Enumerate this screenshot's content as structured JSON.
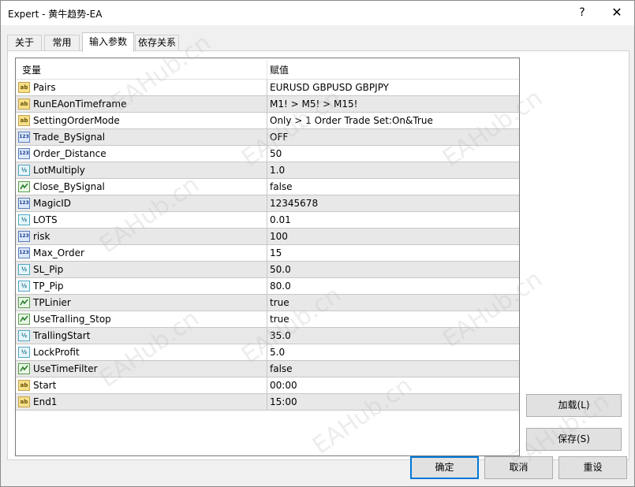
{
  "window": {
    "title": "Expert - 黄牛趋势-EA",
    "help_label": "?",
    "close_label": "✕"
  },
  "tabs": [
    {
      "label": "关于"
    },
    {
      "label": "常用"
    },
    {
      "label": "输入参数"
    },
    {
      "label": "依存关系"
    }
  ],
  "grid": {
    "header": {
      "variable": "变量",
      "value": "赋值"
    },
    "rows": [
      {
        "type": "ab",
        "name": "Pairs",
        "value": "EURUSD GBPUSD GBPJPY"
      },
      {
        "type": "ab",
        "name": "RunEAonTimeframe",
        "value": "M1! > M5! > M15!"
      },
      {
        "type": "ab",
        "name": "SettingOrderMode",
        "value": "Only > 1 Order Trade Set:On&True"
      },
      {
        "type": "123",
        "name": "Trade_BySignal",
        "value": "OFF"
      },
      {
        "type": "123",
        "name": "Order_Distance",
        "value": "50"
      },
      {
        "type": "v12",
        "name": "LotMultiply",
        "value": "1.0"
      },
      {
        "type": "bool",
        "name": "Close_BySignal",
        "value": "false"
      },
      {
        "type": "123",
        "name": "MagicID",
        "value": "12345678"
      },
      {
        "type": "v12",
        "name": "LOTS",
        "value": "0.01"
      },
      {
        "type": "123",
        "name": "risk",
        "value": "100"
      },
      {
        "type": "123",
        "name": "Max_Order",
        "value": "15"
      },
      {
        "type": "v12",
        "name": "SL_Pip",
        "value": "50.0"
      },
      {
        "type": "v12",
        "name": "TP_Pip",
        "value": "80.0"
      },
      {
        "type": "bool",
        "name": "TPLinier",
        "value": "true"
      },
      {
        "type": "bool",
        "name": "UseTralling_Stop",
        "value": "true"
      },
      {
        "type": "v12",
        "name": "TrallingStart",
        "value": "35.0"
      },
      {
        "type": "v12",
        "name": "LockProfit",
        "value": "5.0"
      },
      {
        "type": "bool",
        "name": "UseTimeFilter",
        "value": "false"
      },
      {
        "type": "ab",
        "name": "Start",
        "value": "00:00"
      },
      {
        "type": "ab",
        "name": "End1",
        "value": "15:00"
      }
    ]
  },
  "icons": {
    "ab": "string-type-icon",
    "123": "integer-type-icon",
    "v12": "double-type-icon",
    "bool": "bool-type-icon"
  },
  "icon_glyphs": {
    "ab": "ab",
    "123": "123",
    "v12": "½"
  },
  "buttons": {
    "load": "加载(L)",
    "save": "保存(S)",
    "ok": "确定",
    "cancel": "取消",
    "reset": "重设"
  },
  "watermark": "EAHub.cn",
  "colors": {
    "row_alt": "#e8e8e8",
    "default_button_border": "#0078d7"
  }
}
